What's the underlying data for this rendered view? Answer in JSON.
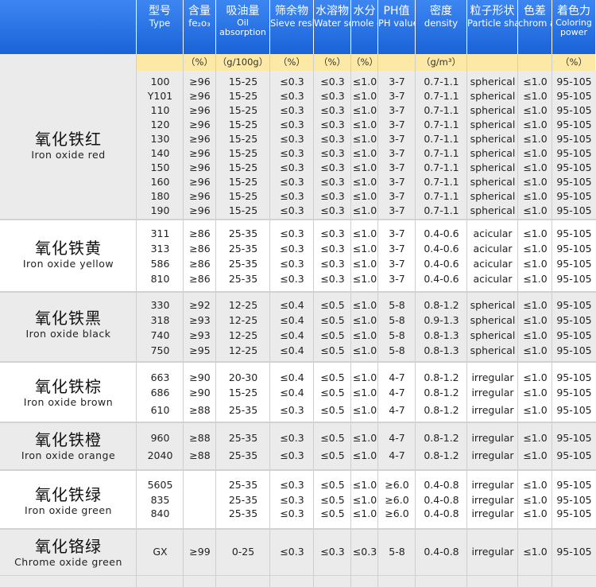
{
  "header": {
    "columns": [
      {
        "zh": "",
        "en": "",
        "unit": ""
      },
      {
        "zh": "型号",
        "en": "Type",
        "unit": ""
      },
      {
        "zh": "含量",
        "en": "fe₂o₃",
        "unit": "（%）"
      },
      {
        "zh": "吸油量",
        "en": "Oil absorption",
        "unit": "（g/100g）"
      },
      {
        "zh": "筛余物",
        "en": "Sieve residue",
        "unit": "（%）"
      },
      {
        "zh": "水溶物",
        "en": "Water soluble",
        "unit": "（%）"
      },
      {
        "zh": "水分",
        "en": "mole cule",
        "unit": "（%）"
      },
      {
        "zh": "PH值",
        "en": "PH value",
        "unit": ""
      },
      {
        "zh": "密度",
        "en": "density",
        "unit": "（g/m³）"
      },
      {
        "zh": "粒子形状",
        "en": "Particle shape",
        "unit": ""
      },
      {
        "zh": "色差",
        "en": "chrom atism",
        "unit": ""
      },
      {
        "zh": "着色力",
        "en": "Coloring power",
        "unit": "（%）"
      }
    ]
  },
  "products": [
    {
      "name_zh": "氧化铁红",
      "name_en": "Iron oxide red",
      "rows": [
        [
          "100",
          "≥96",
          "15-25",
          "≤0.3",
          "≤0.3",
          "≤1.0",
          "3-7",
          "0.7-1.1",
          "spherical",
          "≤1.0",
          "95-105"
        ],
        [
          "Y101",
          "≥96",
          "15-25",
          "≤0.3",
          "≤0.3",
          "≤1.0",
          "3-7",
          "0.7-1.1",
          "spherical",
          "≤1.0",
          "95-105"
        ],
        [
          "110",
          "≥96",
          "15-25",
          "≤0.3",
          "≤0.3",
          "≤1.0",
          "3-7",
          "0.7-1.1",
          "spherical",
          "≤1.0",
          "95-105"
        ],
        [
          "120",
          "≥96",
          "15-25",
          "≤0.3",
          "≤0.3",
          "≤1.0",
          "3-7",
          "0.7-1.1",
          "spherical",
          "≤1.0",
          "95-105"
        ],
        [
          "130",
          "≥96",
          "15-25",
          "≤0.3",
          "≤0.3",
          "≤1.0",
          "3-7",
          "0.7-1.1",
          "spherical",
          "≤1.0",
          "95-105"
        ],
        [
          "140",
          "≥96",
          "15-25",
          "≤0.3",
          "≤0.3",
          "≤1.0",
          "3-7",
          "0.7-1.1",
          "spherical",
          "≤1.0",
          "95-105"
        ],
        [
          "150",
          "≥96",
          "15-25",
          "≤0.3",
          "≤0.3",
          "≤1.0",
          "3-7",
          "0.7-1.1",
          "spherical",
          "≤1.0",
          "95-105"
        ],
        [
          "160",
          "≥96",
          "15-25",
          "≤0.3",
          "≤0.3",
          "≤1.0",
          "3-7",
          "0.7-1.1",
          "spherical",
          "≤1.0",
          "95-105"
        ],
        [
          "180",
          "≥96",
          "15-25",
          "≤0.3",
          "≤0.3",
          "≤1.0",
          "3-7",
          "0.7-1.1",
          "spherical",
          "≤1.0",
          "95-105"
        ],
        [
          "190",
          "≥96",
          "15-25",
          "≤0.3",
          "≤0.3",
          "≤1.0",
          "3-7",
          "0.7-1.1",
          "spherical",
          "≤1.0",
          "95-105"
        ]
      ]
    },
    {
      "name_zh": "氧化铁黄",
      "name_en": "Iron oxide yellow",
      "rows": [
        [
          "311",
          "≥86",
          "25-35",
          "≤0.3",
          "≤0.3",
          "≤1.0",
          "3-7",
          "0.4-0.6",
          "acicular",
          "≤1.0",
          "95-105"
        ],
        [
          "313",
          "≥86",
          "25-35",
          "≤0.3",
          "≤0.3",
          "≤1.0",
          "3-7",
          "0.4-0.6",
          "acicular",
          "≤1.0",
          "95-105"
        ],
        [
          "586",
          "≥86",
          "25-35",
          "≤0.3",
          "≤0.3",
          "≤1.0",
          "3-7",
          "0.4-0.6",
          "acicular",
          "≤1.0",
          "95-105"
        ],
        [
          "810",
          "≥86",
          "25-35",
          "≤0.3",
          "≤0.3",
          "≤1.0",
          "3-7",
          "0.4-0.6",
          "acicular",
          "≤1.0",
          "95-105"
        ]
      ]
    },
    {
      "name_zh": "氧化铁黑",
      "name_en": "Iron oxide black",
      "rows": [
        [
          "330",
          "≥92",
          "12-25",
          "≤0.4",
          "≤0.5",
          "≤1.0",
          "5-8",
          "0.8-1.2",
          "spherical",
          "≤1.0",
          "95-105"
        ],
        [
          "318",
          "≥93",
          "12-25",
          "≤0.4",
          "≤0.5",
          "≤1.0",
          "5-8",
          "0.9-1.3",
          "spherical",
          "≤1.0",
          "95-105"
        ],
        [
          "740",
          "≥93",
          "12-25",
          "≤0.4",
          "≤0.5",
          "≤1.0",
          "5-8",
          "0.8-1.3",
          "spherical",
          "≤1.0",
          "95-105"
        ],
        [
          "750",
          "≥95",
          "12-25",
          "≤0.4",
          "≤0.5",
          "≤1.0",
          "5-8",
          "0.8-1.3",
          "spherical",
          "≤1.0",
          "95-105"
        ]
      ]
    },
    {
      "name_zh": "氧化铁棕",
      "name_en": "Iron oxide brown",
      "rows": [
        [
          "663",
          "≥90",
          "20-30",
          "≤0.4",
          "≤0.5",
          "≤1.0",
          "4-7",
          "0.8-1.2",
          "irregular",
          "≤1.0",
          "95-105"
        ],
        [
          "686",
          "≥90",
          "15-25",
          "≤0.4",
          "≤0.5",
          "≤1.0",
          "4-7",
          "0.8-1.2",
          "irregular",
          "≤1.0",
          "95-105"
        ],
        [
          "610",
          "≥88",
          "25-35",
          "≤0.3",
          "≤0.5",
          "≤1.0",
          "4-7",
          "0.8-1.2",
          "irregular",
          "≤1.0",
          "95-105"
        ]
      ]
    },
    {
      "name_zh": "氧化铁橙",
      "name_en": "Iron oxide orange",
      "rows": [
        [
          "960",
          "≥88",
          "25-35",
          "≤0.3",
          "≤0.5",
          "≤1.0",
          "4-7",
          "0.8-1.2",
          "irregular",
          "≤1.0",
          "95-105"
        ],
        [
          "2040",
          "≥88",
          "25-35",
          "≤0.3",
          "≤0.5",
          "≤1.0",
          "4-7",
          "0.8-1.2",
          "irregular",
          "≤1.0",
          "95-105"
        ]
      ]
    },
    {
      "name_zh": "氧化铁绿",
      "name_en": "Iron oxide green",
      "rows": [
        [
          "5605",
          "",
          "25-35",
          "≤0.3",
          "≤0.5",
          "≤1.0",
          "≥6.0",
          "0.4-0.8",
          "irregular",
          "≤1.0",
          "95-105"
        ],
        [
          "835",
          "",
          "25-35",
          "≤0.3",
          "≤0.5",
          "≤1.0",
          "≥6.0",
          "0.4-0.8",
          "irregular",
          "≤1.0",
          "95-105"
        ],
        [
          "840",
          "",
          "25-35",
          "≤0.3",
          "≤0.5",
          "≤1.0",
          "≥6.0",
          "0.4-0.8",
          "irregular",
          "≤1.0",
          "95-105"
        ]
      ]
    },
    {
      "name_zh": "氧化铬绿",
      "name_en": "Chrome oxide green",
      "rows": [
        [
          "GX",
          "≥99",
          "0-25",
          "≤0.3",
          "≤0.3",
          "≤0.3",
          "5-8",
          "0.4-0.8",
          "irregular",
          "≤1.0",
          "95-105"
        ]
      ]
    }
  ],
  "colors": {
    "header_blue": "#1f6ce0",
    "unit_yellow": "#fde9a6",
    "band_gray": "#ebebeb"
  }
}
